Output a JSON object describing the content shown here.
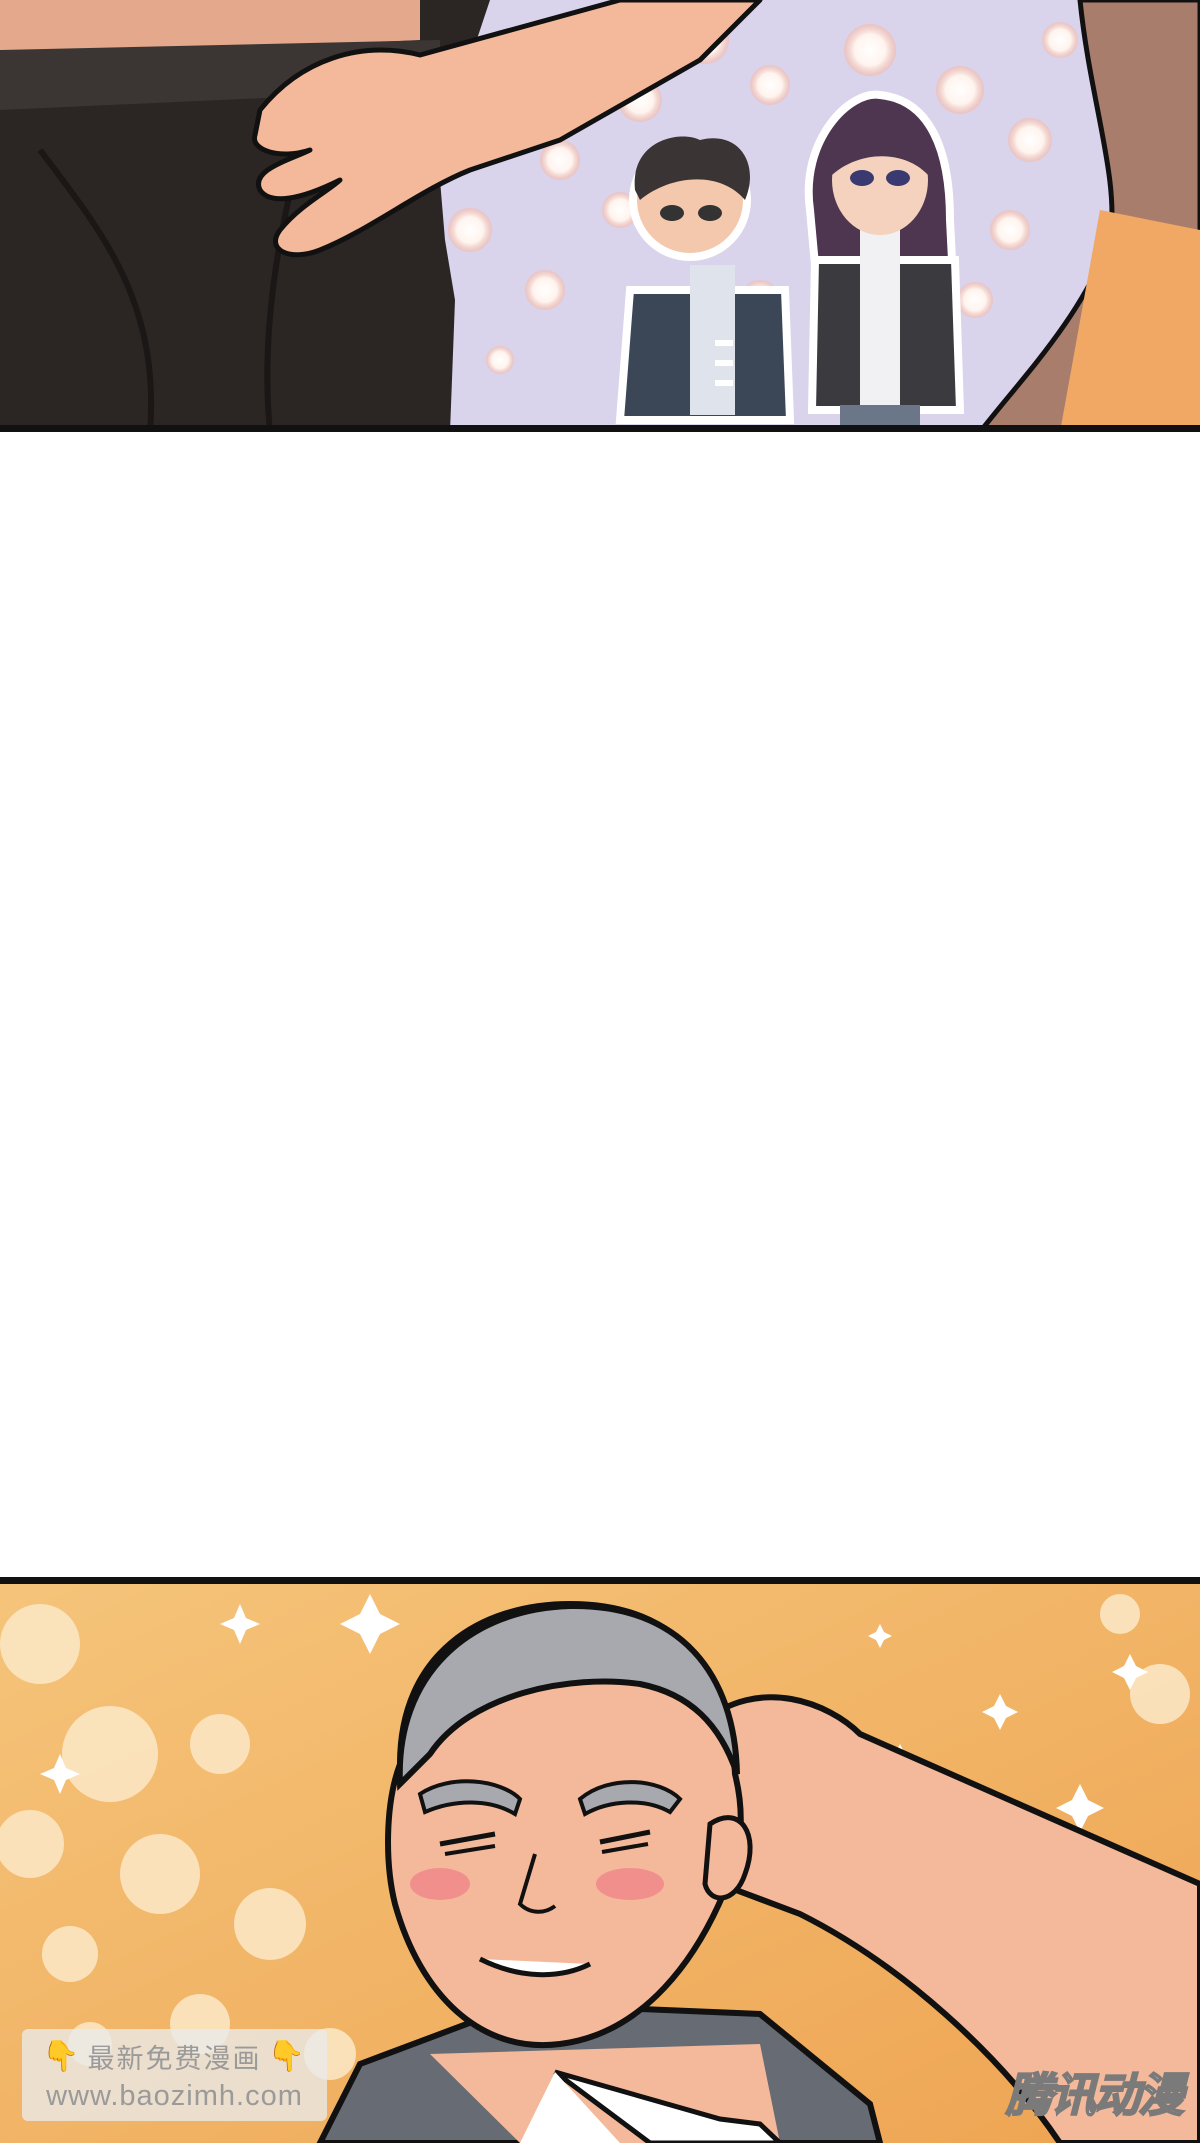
{
  "watermark": {
    "emoji_left": "👇",
    "title": "最新免费漫画",
    "emoji_right": "👇",
    "url": "www.baozimh.com"
  },
  "brand": {
    "logo_text": "腾讯动漫"
  },
  "colors": {
    "top_background": "#d9d3ec",
    "bottom_background": "#f1b865",
    "panel_border": "#111111",
    "skin": "#f4b99a",
    "hair_gray": "#a7a9ae"
  }
}
